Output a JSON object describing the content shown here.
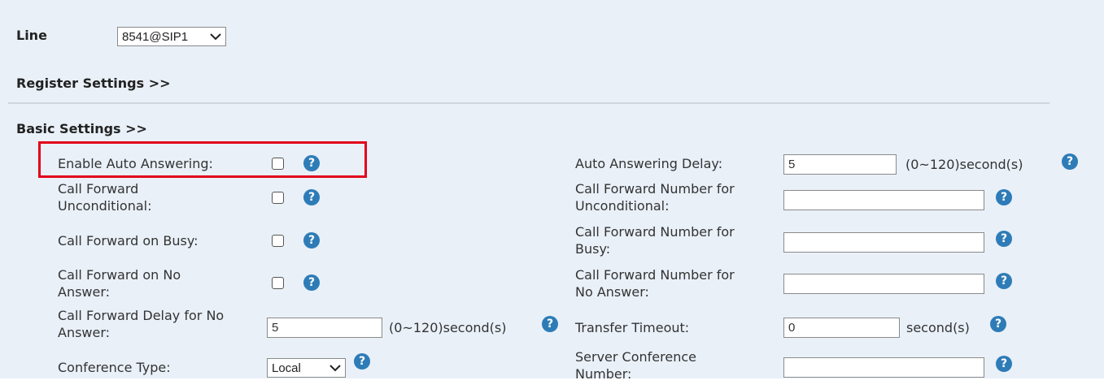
{
  "line": {
    "label": "Line",
    "selected": "8541@SIP1"
  },
  "sections": {
    "register": "Register Settings >>",
    "basic": "Basic Settings >>"
  },
  "help_glyph": "?",
  "left": {
    "enable_auto_answering": {
      "label": "Enable Auto Answering:",
      "checked": false
    },
    "call_forward_unconditional": {
      "label_line1": "Call Forward",
      "label_line2": "Unconditional:",
      "checked": false
    },
    "call_forward_on_busy": {
      "label": "Call Forward on Busy:",
      "checked": false
    },
    "call_forward_on_no_answer": {
      "label_line1": "Call Forward on No",
      "label_line2": "Answer:",
      "checked": false
    },
    "call_forward_delay": {
      "label_line1": "Call Forward Delay for No",
      "label_line2": "Answer:",
      "value": "5",
      "unit": "(0~120)second(s)"
    },
    "conference_type": {
      "label": "Conference Type:",
      "selected": "Local"
    }
  },
  "right": {
    "auto_answering_delay": {
      "label": "Auto Answering Delay:",
      "value": "5",
      "unit": "(0~120)second(s)"
    },
    "cf_number_unconditional": {
      "label_line1": "Call Forward Number for",
      "label_line2": "Unconditional:",
      "value": ""
    },
    "cf_number_busy": {
      "label_line1": "Call Forward Number for",
      "label_line2": "Busy:",
      "value": ""
    },
    "cf_number_no_answer": {
      "label_line1": "Call Forward Number for",
      "label_line2": "No Answer:",
      "value": ""
    },
    "transfer_timeout": {
      "label": "Transfer Timeout:",
      "value": "0",
      "unit": "second(s)"
    },
    "server_conference_number": {
      "label_line1": "Server Conference",
      "label_line2": "Number:",
      "value": ""
    }
  },
  "colors": {
    "panel_bg": "#e9f0f8",
    "help_icon": "#2e7cb7",
    "highlight_border": "#e2001a"
  }
}
